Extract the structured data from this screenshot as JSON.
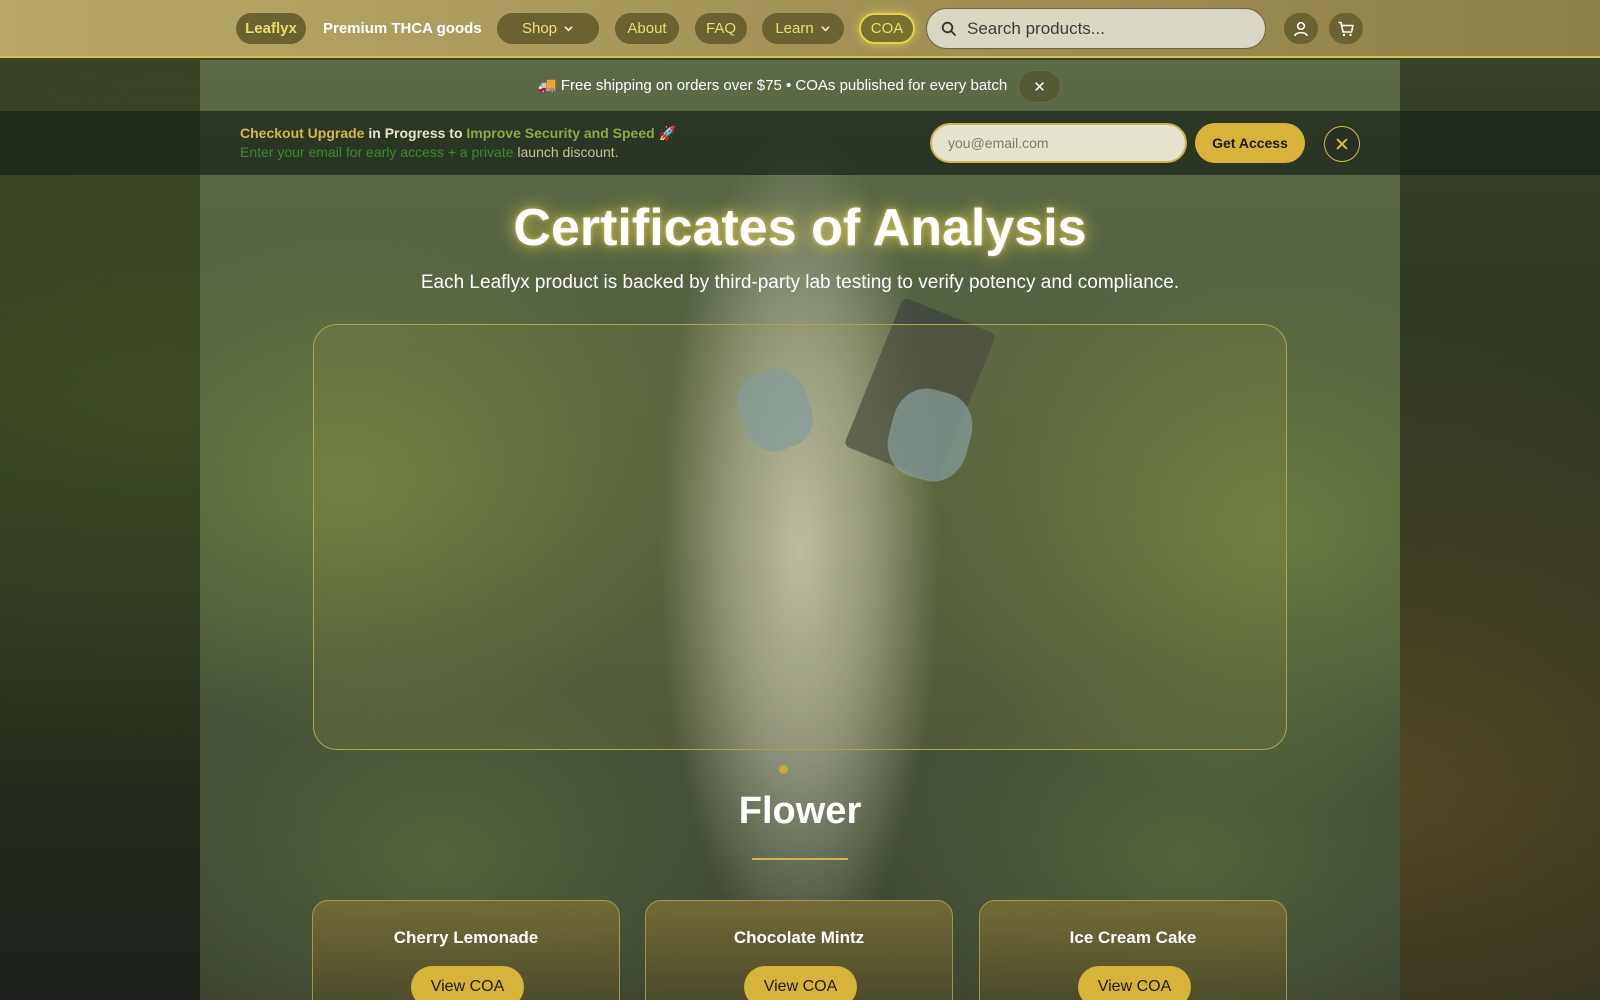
{
  "header": {
    "brand": "Leaflyx",
    "tagline": "Premium THCA goods",
    "nav": {
      "shop": "Shop",
      "about": "About",
      "faq": "FAQ",
      "learn": "Learn",
      "coa": "COA"
    },
    "search_placeholder": "Search products..."
  },
  "shipping_bar": {
    "text": "🚚 Free shipping on orders over $75 • COAs published for every batch",
    "close": "✕"
  },
  "announcement": {
    "line1_part1": "Checkout Upgrade",
    "line1_part2": " in Progress to ",
    "line1_part3": "Improve Security and Speed",
    "line1_part4": " 🚀",
    "line2_part1": "Enter your email for early access + a private ",
    "line2_part2": "launch discount.",
    "email_placeholder": "you@email.com",
    "button": "Get Access"
  },
  "hero": {
    "title": "Certificates of Analysis",
    "subtitle": "Each Leaflyx product is backed by third-party lab testing to verify potency and compliance."
  },
  "section": {
    "title": "Flower",
    "products": [
      {
        "name": "Cherry Lemonade",
        "button": "View COA"
      },
      {
        "name": "Chocolate Mintz",
        "button": "View COA"
      },
      {
        "name": "Ice Cream Cake",
        "button": "View COA"
      }
    ]
  },
  "colors": {
    "accent_gold": "#d7b33a",
    "header_bg": "#a49358",
    "pill_bg": "#6b6232"
  }
}
